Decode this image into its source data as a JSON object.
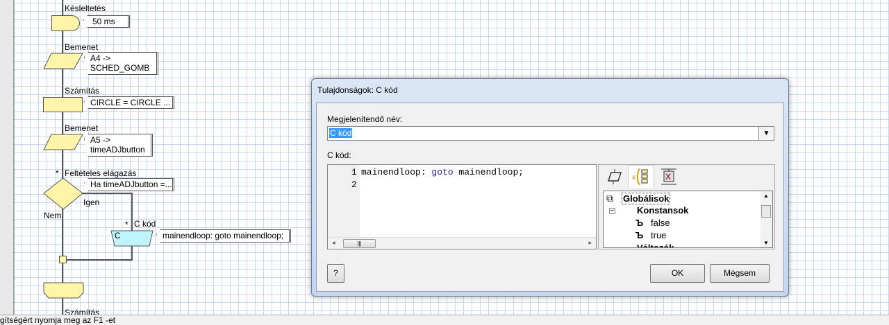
{
  "flowchart": {
    "blocks": [
      {
        "type": "delay",
        "label": "Késleltetés",
        "comment": "50 ms"
      },
      {
        "type": "input",
        "label": "Bemenet",
        "comment": [
          "A4 ->",
          "SCHED_GOMB"
        ]
      },
      {
        "type": "calculation",
        "label": "Számítás",
        "comment": "CIRCLE = CIRCLE ..."
      },
      {
        "type": "input",
        "label": "Bemenet",
        "comment": [
          "A5 ->",
          "timeADJbutton"
        ]
      },
      {
        "type": "decision",
        "label": "Feltételes elágazás",
        "comment": "Ha timeADJbutton =...",
        "yes": "Igen",
        "no": "Nem"
      },
      {
        "type": "c-code",
        "label": "C kód",
        "shape_text": "C",
        "comment": "mainendloop: goto mainendloop;"
      },
      {
        "type": "calculation",
        "label": "Számítás"
      }
    ],
    "star": "*",
    "colors": {
      "block": "#fff5a8",
      "c_block": "#bff4fa",
      "grid": "#c8d8ec"
    }
  },
  "status_bar": {
    "text": "gítségért nyomja meg az F1 -et"
  },
  "dialog": {
    "title": "Tulajdonságok: C kód",
    "name_label": "Megjelenítendő név:",
    "name_value": "C kód",
    "code_label": "C kód:",
    "code_lines": [
      {
        "num": "1",
        "text": "mainendloop: ",
        "kw": "goto",
        "rest": " mainendloop;"
      },
      {
        "num": "2",
        "text": ""
      }
    ],
    "tabs": [
      {
        "icon": "block-icon"
      },
      {
        "icon": "variables-tree-icon",
        "active": true
      },
      {
        "icon": "function-icon"
      }
    ],
    "tree": {
      "root": "Globálisok",
      "group": "Konstansok",
      "items": [
        "false",
        "true"
      ],
      "partial": "Változók"
    },
    "help_label": "?",
    "ok_label": "OK",
    "cancel_label": "Mégsem"
  }
}
